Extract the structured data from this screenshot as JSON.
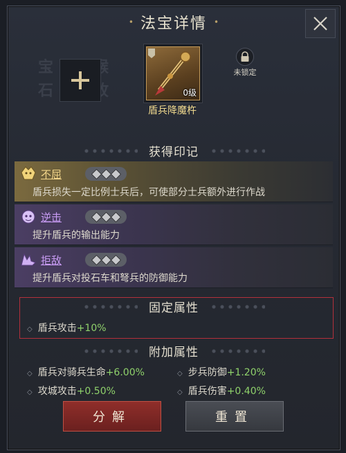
{
  "window": {
    "title": "法宝详情"
  },
  "item": {
    "name": "盾兵降魔杵",
    "level": "0级",
    "lock_label": "未锁定",
    "watermark_left": [
      "宝",
      "石"
    ],
    "watermark_right": [
      "猴",
      "故"
    ]
  },
  "seals_section": {
    "title": "获得印记",
    "seals": [
      {
        "name": "不屈",
        "desc": "盾兵损失一定比例士兵后，可使部分士兵额外进行作战",
        "rarity": "gold"
      },
      {
        "name": "逆击",
        "desc": "提升盾兵的输出能力",
        "rarity": "purple"
      },
      {
        "name": "拒敌",
        "desc": "提升盾兵对投石车和弩兵的防御能力",
        "rarity": "purple"
      }
    ]
  },
  "fixed_attrs": {
    "title": "固定属性",
    "items": [
      {
        "label": "盾兵攻击",
        "value": "+10%"
      }
    ]
  },
  "extra_attrs": {
    "title": "附加属性",
    "items": [
      {
        "label": "盾兵对骑兵生命",
        "value": "+6.00%"
      },
      {
        "label": "步兵防御",
        "value": "+1.20%"
      },
      {
        "label": "攻城攻击",
        "value": "+0.50%"
      },
      {
        "label": "盾兵伤害",
        "value": "+0.40%"
      }
    ]
  },
  "buttons": {
    "decompose": "分解",
    "reset": "重置"
  },
  "colors": {
    "value_green": "#8fd16b",
    "gold_name": "#f3d68a",
    "purple_name": "#c99cf5",
    "highlight_border": "#b3303b"
  }
}
